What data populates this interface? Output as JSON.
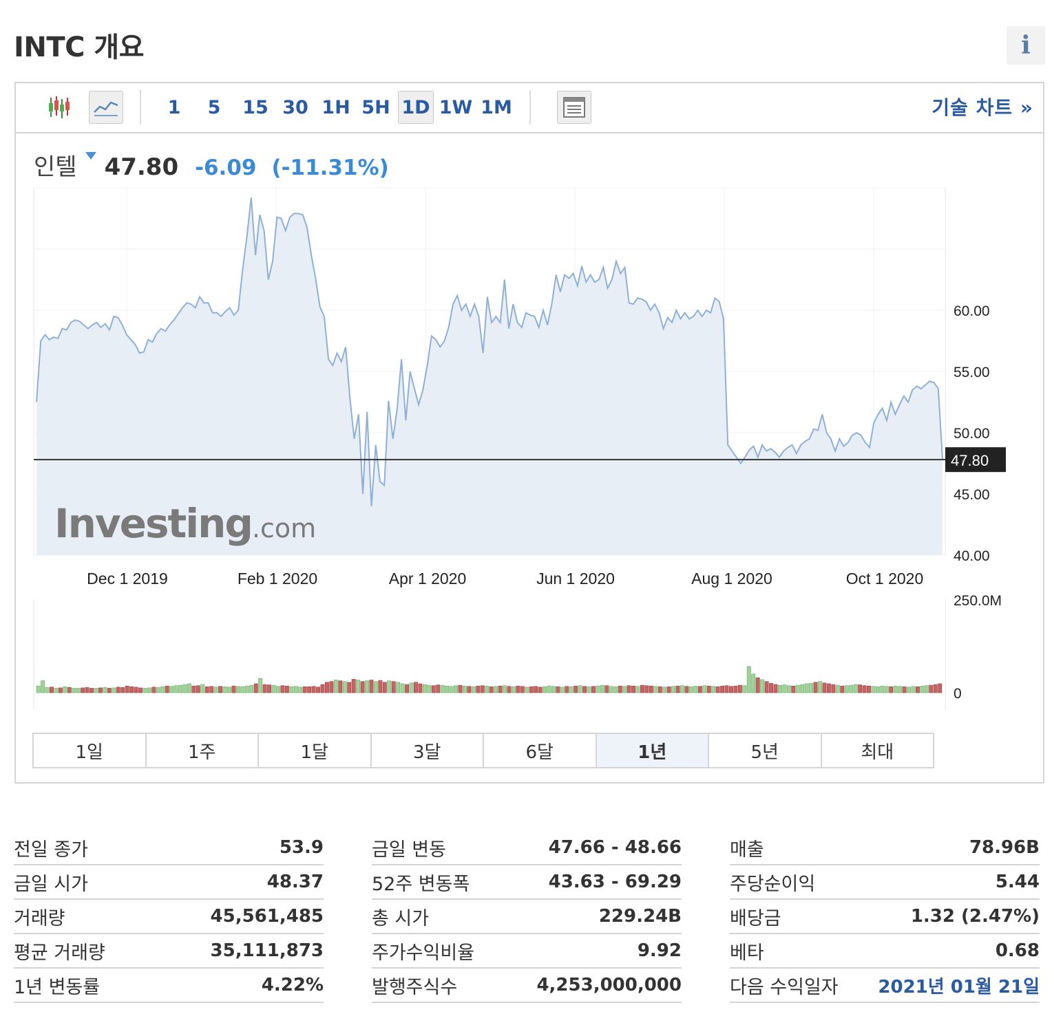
{
  "title": "INTC 개요",
  "info_label": "i",
  "toolbar": {
    "intervals": [
      {
        "label": "1",
        "active": false
      },
      {
        "label": "5",
        "active": false
      },
      {
        "label": "15",
        "active": false
      },
      {
        "label": "30",
        "active": false
      },
      {
        "label": "1H",
        "active": false
      },
      {
        "label": "5H",
        "active": false
      },
      {
        "label": "1D",
        "active": true
      },
      {
        "label": "1W",
        "active": false
      },
      {
        "label": "1M",
        "active": false
      }
    ],
    "tech_chart_label": "기술 차트 »"
  },
  "quote": {
    "name": "인텔",
    "price": "47.80",
    "change": "-6.09",
    "change_pct": "(-11.31%)"
  },
  "colors": {
    "accent": "#2a5aa0",
    "line": "#8fb0d6",
    "area": "#e8eef6",
    "vol_up": "#9fd39a",
    "vol_down": "#c46464",
    "change_blue": "#3a8ad6"
  },
  "chart_data": {
    "type": "area",
    "x_ticks": [
      "Dec 1 2019",
      "Feb 1 2020",
      "Apr 1 2020",
      "Jun 1 2020",
      "Aug 1 2020",
      "Oct 1 2020"
    ],
    "y_ticks": [
      "60.00",
      "55.00",
      "50.00",
      "45.00",
      "40.00"
    ],
    "ylim": [
      40,
      70
    ],
    "last_price_label": "47.80",
    "watermark": "Investing.com",
    "series": [
      {
        "values": [
          52.5,
          57.5,
          58.0,
          57.6,
          57.8,
          57.7,
          58.5,
          58.4,
          59.0,
          59.2,
          59.1,
          58.8,
          58.5,
          58.8,
          59.0,
          58.6,
          58.9,
          58.4,
          59.5,
          59.4,
          58.8,
          58.0,
          57.6,
          57.2,
          56.5,
          56.6,
          57.6,
          57.4,
          58.1,
          58.5,
          58.3,
          58.8,
          59.2,
          59.7,
          60.2,
          60.6,
          60.5,
          60.2,
          61.1,
          60.6,
          60.6,
          59.8,
          59.8,
          59.5,
          59.9,
          60.2,
          59.6,
          60.0,
          63.3,
          66.0,
          69.2,
          64.5,
          67.8,
          66.5,
          62.5,
          64.0,
          67.6,
          67.5,
          66.5,
          67.6,
          67.9,
          67.9,
          67.8,
          66.8,
          64.5,
          62.6,
          60.3,
          59.5,
          56.0,
          55.5,
          56.5,
          55.8,
          57.0,
          52.8,
          49.5,
          51.5,
          45.0,
          51.7,
          44.0,
          49.0,
          46.0,
          45.7,
          52.6,
          49.5,
          52.0,
          56.0,
          51.0,
          55.0,
          53.6,
          52.3,
          53.5,
          55.5,
          57.9,
          57.6,
          57.0,
          57.5,
          58.6,
          60.5,
          61.2,
          60.0,
          60.5,
          59.5,
          60.5,
          59.5,
          56.5,
          61.1,
          59.0,
          59.5,
          59.0,
          62.5,
          58.5,
          60.5,
          59.0,
          58.6,
          59.8,
          59.6,
          59.5,
          58.6,
          60.0,
          58.8,
          60.5,
          62.9,
          61.5,
          62.9,
          62.6,
          63.0,
          62.0,
          63.6,
          62.3,
          62.9,
          62.3,
          62.5,
          63.5,
          61.8,
          62.5,
          64.0,
          63.0,
          63.5,
          60.6,
          60.5,
          61.0,
          60.9,
          60.7,
          60.0,
          60.5,
          59.8,
          58.5,
          59.4,
          59.0,
          60.0,
          59.3,
          59.8,
          59.3,
          59.5,
          60.0,
          59.5,
          60.0,
          59.8,
          61.0,
          60.7,
          59.3,
          49.0,
          48.5,
          48.0,
          47.5,
          48.0,
          48.6,
          48.9,
          48.0,
          49.0,
          48.5,
          48.7,
          48.4,
          48.0,
          48.5,
          48.8,
          49.0,
          48.3,
          49.0,
          49.3,
          49.5,
          50.3,
          50.2,
          51.5,
          50.0,
          49.5,
          48.5,
          49.5,
          48.9,
          49.2,
          49.8,
          50.0,
          49.8,
          49.2,
          48.8,
          50.8,
          51.5,
          52.0,
          51.0,
          52.5,
          51.5,
          52.3,
          53.0,
          52.5,
          53.5,
          53.8,
          53.6,
          53.9,
          54.2,
          54.1,
          53.6,
          47.8
        ]
      },
      {
        "name": "volume",
        "values": [
          18,
          32,
          14,
          15,
          12,
          13,
          16,
          14,
          12,
          12,
          13,
          14,
          12,
          12,
          13,
          14,
          12,
          13,
          15,
          14,
          18,
          16,
          15,
          13,
          12,
          13,
          15,
          14,
          16,
          18,
          17,
          19,
          20,
          22,
          24,
          18,
          19,
          22,
          16,
          17,
          15,
          17,
          16,
          15,
          18,
          17,
          16,
          18,
          20,
          24,
          38,
          22,
          21,
          20,
          17,
          19,
          18,
          16,
          17,
          15,
          16,
          16,
          17,
          15,
          22,
          28,
          30,
          34,
          32,
          30,
          28,
          36,
          34,
          30,
          32,
          34,
          30,
          33,
          28,
          32,
          30,
          28,
          24,
          22,
          26,
          28,
          24,
          22,
          20,
          19,
          21,
          20,
          18,
          17,
          19,
          20,
          18,
          17,
          16,
          18,
          19,
          18,
          16,
          17,
          18,
          19,
          17,
          16,
          18,
          17,
          15,
          16,
          17,
          15,
          16,
          18,
          17,
          16,
          15,
          17,
          16,
          18,
          19,
          17,
          16,
          17,
          18,
          20,
          19,
          17,
          16,
          18,
          17,
          19,
          18,
          17,
          20,
          19,
          18,
          17,
          16,
          15,
          16,
          17,
          18,
          19,
          17,
          16,
          18,
          17,
          19,
          18,
          17,
          16,
          18,
          19,
          17,
          18,
          20,
          19,
          70,
          50,
          40,
          35,
          30,
          25,
          22,
          20,
          21,
          19,
          18,
          20,
          22,
          24,
          25,
          28,
          30,
          26,
          24,
          22,
          20,
          18,
          19,
          20,
          22,
          21,
          19,
          18,
          17,
          16,
          18,
          17,
          16,
          18,
          17,
          16,
          15,
          17,
          16,
          18,
          19,
          20,
          22,
          24
        ]
      }
    ],
    "volume_ticks": [
      "250.0M",
      "0"
    ]
  },
  "ranges": [
    {
      "label": "1일",
      "active": false
    },
    {
      "label": "1주",
      "active": false
    },
    {
      "label": "1달",
      "active": false
    },
    {
      "label": "3달",
      "active": false
    },
    {
      "label": "6달",
      "active": false
    },
    {
      "label": "1년",
      "active": true
    },
    {
      "label": "5년",
      "active": false
    },
    {
      "label": "최대",
      "active": false
    }
  ],
  "stats": [
    [
      {
        "label": "전일 종가",
        "value": "53.9"
      },
      {
        "label": "금일 시가",
        "value": "48.37"
      },
      {
        "label": "거래량",
        "value": "45,561,485"
      },
      {
        "label": "평균 거래량",
        "value": "35,111,873"
      },
      {
        "label": "1년 변동률",
        "value": "4.22%"
      }
    ],
    [
      {
        "label": "금일 변동",
        "value": "47.66 - 48.66"
      },
      {
        "label": "52주 변동폭",
        "value": "43.63 - 69.29"
      },
      {
        "label": "총 시가",
        "value": "229.24B"
      },
      {
        "label": "주가수익비율",
        "value": "9.92"
      },
      {
        "label": "발행주식수",
        "value": "4,253,000,000"
      }
    ],
    [
      {
        "label": "매출",
        "value": "78.96B"
      },
      {
        "label": "주당순이익",
        "value": "5.44"
      },
      {
        "label": "배당금",
        "value": "1.32 (2.47%)"
      },
      {
        "label": "베타",
        "value": "0.68"
      },
      {
        "label": "다음 수익일자",
        "value": "2021년 01월 21일",
        "link": true
      }
    ]
  ]
}
